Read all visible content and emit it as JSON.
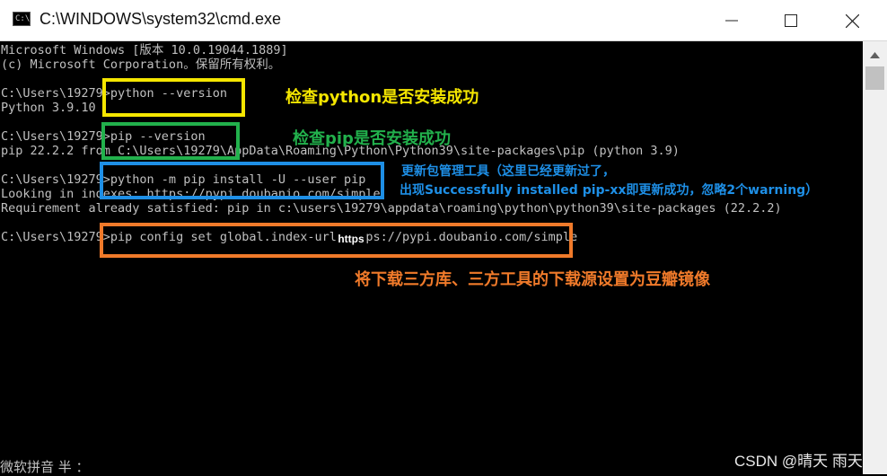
{
  "window": {
    "title": "C:\\WINDOWS\\system32\\cmd.exe"
  },
  "console_lines": [
    "Microsoft Windows [版本 10.0.19044.1889]",
    "(c) Microsoft Corporation。保留所有权利。",
    "C:\\Users\\19279>python --version",
    "Python 3.9.10",
    "C:\\Users\\19279>pip --version",
    "pip 22.2.2 from C:\\Users\\19279\\AppData\\Roaming\\Python\\Python39\\site-packages\\pip (python 3.9)",
    "C:\\Users\\19279>python -m pip install -U --user pip",
    "Looking in indexes: https://pypi.doubanio.com/simple",
    "Requirement already satisfied: pip in c:\\users\\19279\\appdata\\roaming\\python\\python39\\site-packages (22.2.2)",
    "C:\\Users\\19279>pip config set global.index-url https://pypi.doubanio.com/simple"
  ],
  "annotations": {
    "check_python": "检查python是否安装成功",
    "check_pip": "检查pip是否安装成功",
    "update_line1": "更新包管理工具（这里已经更新过了，",
    "update_line2": "出现Successfully installed pip-xx即更新成功，忽略2个warning）",
    "mirror": "将下载三方库、三方工具的下载源设置为豆瓣镜像",
    "https_label": "https"
  },
  "colors": {
    "yellow": "#f5e600",
    "green": "#22b14c",
    "blue": "#1e8fe6",
    "orange": "#f07a2a"
  },
  "status": {
    "ime": "微软拼音 半 ：",
    "watermark": "CSDN @晴天 雨天"
  },
  "icons": [
    "cmd-app-icon",
    "minimize-icon",
    "maximize-icon",
    "close-icon",
    "scroll-up-arrow-icon"
  ]
}
